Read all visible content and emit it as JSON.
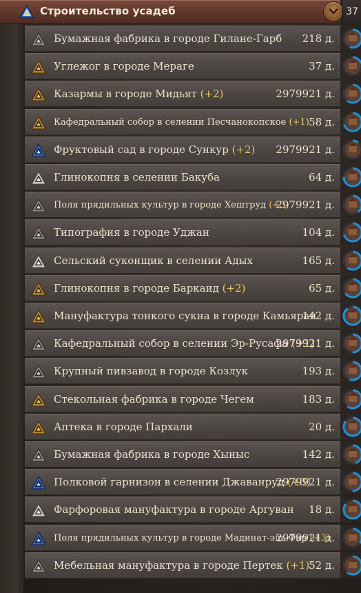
{
  "header": {
    "title": "Строительство усадеб",
    "count": "37",
    "collapse_icon": "chevron-down-icon"
  },
  "colors": {
    "header_bg": "#5e372c",
    "row_bg": "#4e4844",
    "bonus": "#e8c766",
    "ring": "#1e8fd6"
  },
  "rows": [
    {
      "name": "Бумажная фабрика в городе Гилане-Гарб",
      "bonus": "",
      "days": "218 д.",
      "icon": "grey-triangle-icon",
      "small": false,
      "progress": 0.55
    },
    {
      "name": "Углежог в городе Мераге",
      "bonus": "",
      "days": "37 д.",
      "icon": "gold-triangle-icon",
      "small": false,
      "progress": 0.2
    },
    {
      "name": "Казармы в городе Мидьят ",
      "bonus": "(+2)",
      "days": "2979921 д.",
      "icon": "gold-triangle-icon",
      "small": false,
      "progress": 0.6
    },
    {
      "name": "Кафедральный собор в селении Песчанокопское ",
      "bonus": "(+1)",
      "days": "58 д.",
      "icon": "gold-triangle-icon",
      "small": true,
      "progress": 0.7
    },
    {
      "name": "Фруктовый сад в городе Сункур ",
      "bonus": "(+2)",
      "days": "2979921 д.",
      "icon": "blue-triangle-icon",
      "small": false,
      "progress": 0.1
    },
    {
      "name": "Глинокопня в селении Бакуба",
      "bonus": "",
      "days": "64 д.",
      "icon": "white-triangle-icon",
      "small": false,
      "progress": 0.75
    },
    {
      "name": "Поля прядильных культур в городе Хештруд ",
      "bonus": "(+3)",
      "days": "2979921 д.",
      "icon": "grey-triangle-icon",
      "small": true,
      "progress": 0.4
    },
    {
      "name": "Типография в городе Уджан",
      "bonus": "",
      "days": "104 д.",
      "icon": "grey-triangle-icon",
      "small": false,
      "progress": 0.7
    },
    {
      "name": "Сельский суконщик в селении Адых",
      "bonus": "",
      "days": "165 д.",
      "icon": "white-triangle-icon",
      "small": false,
      "progress": 0.6
    },
    {
      "name": "Глинокопня в городе Баркаид ",
      "bonus": "(+2)",
      "days": "65 д.",
      "icon": "gold-triangle-icon",
      "small": false,
      "progress": 0.65
    },
    {
      "name": "Мануфактура тонкого сукна в городе Камьяран",
      "bonus": "",
      "days": "142 д.",
      "icon": "gold-triangle-icon",
      "small": false,
      "progress": 0.9
    },
    {
      "name": "Кафедральный собор в селении Эр-Русафа ",
      "bonus": "(+1)",
      "days": "2979921 д.",
      "icon": "grey-triangle-icon",
      "small": false,
      "progress": 0.5
    },
    {
      "name": "Крупный пивзавод в городе Козлук",
      "bonus": "",
      "days": "193 д.",
      "icon": "grey-triangle-icon",
      "small": false,
      "progress": 0.55
    },
    {
      "name": "Стекольная фабрика в городе Чегем",
      "bonus": "",
      "days": "183 д.",
      "icon": "gold-triangle-icon",
      "small": false,
      "progress": 0.6
    },
    {
      "name": "Аптека в городе Пархали",
      "bonus": "",
      "days": "20 д.",
      "icon": "gold-triangle-icon",
      "small": false,
      "progress": 0.85
    },
    {
      "name": "Бумажная фабрика в городе Хыныс",
      "bonus": "",
      "days": "142 д.",
      "icon": "grey-triangle-icon",
      "small": false,
      "progress": 0.45
    },
    {
      "name": "Полковой гарнизон в селении Джаванруд ",
      "bonus": "(+3)",
      "days": "2979921 д.",
      "icon": "blue-triangle-icon",
      "small": false,
      "progress": 0.5
    },
    {
      "name": "Фарфоровая мануфактура в городе Аргуван",
      "bonus": "",
      "days": "18 д.",
      "icon": "white-triangle-icon",
      "small": false,
      "progress": 0.85
    },
    {
      "name": "Поля прядильных культур в городе Мадинат-эль-Фар ",
      "bonus": "(+3)",
      "days": "2979921 д.",
      "icon": "blue-triangle-icon",
      "small": true,
      "progress": 0.35
    },
    {
      "name": "Мебельная мануфактура в городе Пертек ",
      "bonus": "(+1)",
      "days": "52 д.",
      "icon": "grey-triangle-icon",
      "small": false,
      "progress": 0.6
    }
  ]
}
